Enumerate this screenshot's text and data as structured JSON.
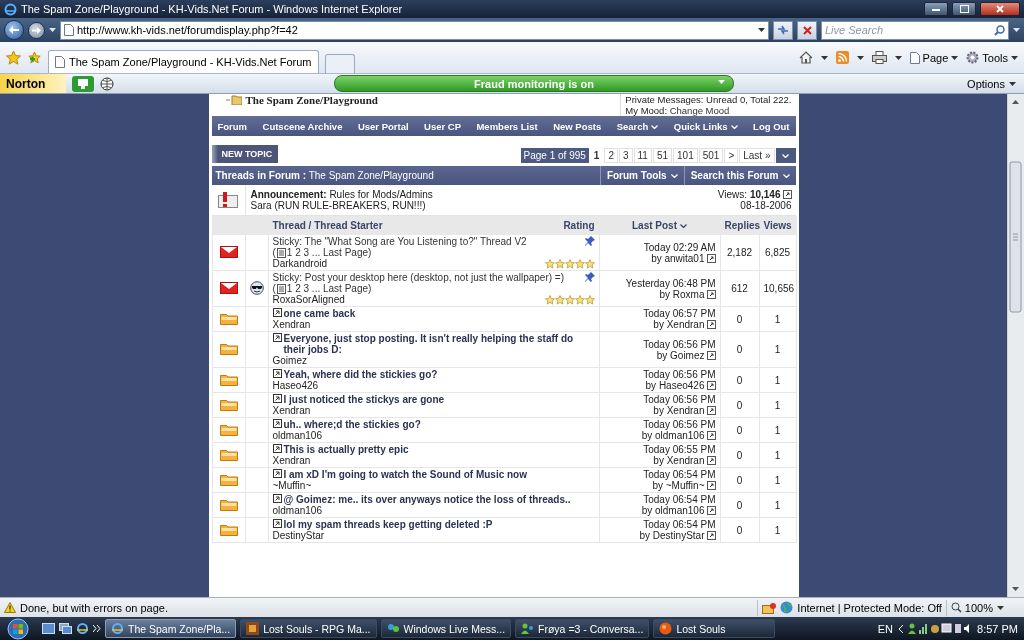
{
  "window": {
    "title": "The Spam Zone/Playground - KH-Vids.Net Forum - Windows Internet Explorer"
  },
  "address_bar": {
    "url": "http://www.kh-vids.net/forumdisplay.php?f=42"
  },
  "search": {
    "placeholder": "Live Search"
  },
  "tabs": [
    {
      "label": "The Spam Zone/Playground - KH-Vids.Net Forum",
      "selected": true
    }
  ],
  "command_bar": [
    {
      "label": "Page"
    },
    {
      "label": "Tools"
    }
  ],
  "norton": {
    "logo": "Norton",
    "status": "Fraud monitoring is on",
    "options": "Options"
  },
  "forum": {
    "title": "The Spam Zone/Playground",
    "messages": "Private Messages: Unread 0, Total 222.",
    "mood_label": "My Mood:",
    "mood_link": "Change Mood"
  },
  "nav": [
    {
      "label": "Forum",
      "menu": false
    },
    {
      "label": "Cutscene Archive",
      "menu": false
    },
    {
      "label": "User Portal",
      "menu": false
    },
    {
      "label": "User CP",
      "menu": false
    },
    {
      "label": "Members List",
      "menu": false
    },
    {
      "label": "New Posts",
      "menu": false
    },
    {
      "label": "Search",
      "menu": true
    },
    {
      "label": "Quick Links",
      "menu": true
    },
    {
      "label": "Log Out",
      "menu": false
    }
  ],
  "new_topic": "NEW TOPIC",
  "pagination": {
    "summary": "Page 1 of 995",
    "pages": [
      {
        "label": "1",
        "selected": true
      },
      {
        "label": "2",
        "selected": false
      },
      {
        "label": "3",
        "selected": false
      },
      {
        "label": "11",
        "selected": false
      },
      {
        "label": "51",
        "selected": false
      },
      {
        "label": "101",
        "selected": false
      },
      {
        "label": "501",
        "selected": false
      },
      {
        "label": ">",
        "selected": false
      },
      {
        "label": "Last »",
        "selected": false
      }
    ]
  },
  "threads_header": {
    "title": "**Threads in Forum :** The Spam Zone/Playground",
    "menus": [
      {
        "label": "Forum Tools"
      },
      {
        "label": "Search this Forum"
      }
    ]
  },
  "announcement": {
    "title": "**Announcement:** Rules for Mods/Admins",
    "author": "Sara (RUN RULE-BREAKERS, RUN!!!)",
    "views": "Views: **10,146**",
    "date": "08-18-2006"
  },
  "columns": [
    {
      "label": "Thread / Thread Starter",
      "sorted": false
    },
    {
      "label": "Rating",
      "sorted": false
    },
    {
      "label": "Last Post",
      "sorted": true
    },
    {
      "label": "Replies",
      "sorted": false
    },
    {
      "label": "Views",
      "sorted": false
    }
  ],
  "threads": [
    {
      "kind": "sticky",
      "thread_icon": false,
      "prefix": "Sticky:",
      "title": "The \"What Song are You Listening to?\" Thread V2",
      "pages_open": "(",
      "pages": "1 2 3 ... Last Page)",
      "starter": "Darkandroid",
      "stars": 5,
      "time": "Today 02:29 AM",
      "by": "by anwita01",
      "replies": "2,182",
      "views": "6,825"
    },
    {
      "kind": "sticky",
      "thread_icon": true,
      "prefix": "Sticky:",
      "title": "Post your desktop here (desktop, not just the wallpaper) =)",
      "pages_open": "(",
      "pages": "1 2 3 ... Last Page)",
      "starter": "RoxaSorAligned",
      "stars": 5,
      "time": "Yesterday 06:48 PM",
      "by": "by Roxma",
      "replies": "612",
      "views": "10,656"
    },
    {
      "kind": "normal",
      "title": "one came back",
      "starter": "Xendran",
      "time": "Today 06:57 PM",
      "by": "by Xendran",
      "replies": "0",
      "views": "1"
    },
    {
      "kind": "normal",
      "title": "Everyone, just stop posting. It isn't really helping the staff do their jobs D:",
      "starter": "Goimez",
      "time": "Today 06:56 PM",
      "by": "by Goimez",
      "replies": "0",
      "views": "1"
    },
    {
      "kind": "normal",
      "title": "Yeah, where did the stickies go?",
      "starter": "Haseo426",
      "time": "Today 06:56 PM",
      "by": "by Haseo426",
      "replies": "0",
      "views": "1"
    },
    {
      "kind": "normal",
      "title": "I just noticed the stickys are gone",
      "starter": "Xendran",
      "time": "Today 06:56 PM",
      "by": "by Xendran",
      "replies": "0",
      "views": "1"
    },
    {
      "kind": "normal",
      "title": "uh.. where;d the stickies go?",
      "starter": "oldman106",
      "time": "Today 06:56 PM",
      "by": "by oldman106",
      "replies": "0",
      "views": "1"
    },
    {
      "kind": "normal",
      "title": "This is actually pretty epic",
      "starter": "Xendran",
      "time": "Today 06:55 PM",
      "by": "by Xendran",
      "replies": "0",
      "views": "1"
    },
    {
      "kind": "normal",
      "title": "I am xD I'm going to watch the Sound of Music now",
      "starter": "~Muffin~",
      "time": "Today 06:54 PM",
      "by": "by ~Muffin~",
      "replies": "0",
      "views": "1"
    },
    {
      "kind": "normal",
      "title": "@ Goimez: me.. its over anyways notice the loss of threads..",
      "starter": "oldman106",
      "time": "Today 06:54 PM",
      "by": "by oldman106",
      "replies": "0",
      "views": "1"
    },
    {
      "kind": "normal",
      "title": "lol my spam threads keep getting deleted :P",
      "starter": "DestinyStar",
      "time": "Today 06:54 PM",
      "by": "by DestinyStar",
      "replies": "0",
      "views": "1"
    }
  ],
  "status_bar": {
    "message": "Done, but with errors on page.",
    "zone": "Internet | Protected Mode: Off",
    "zoom": "100%"
  },
  "taskbar": {
    "tasks": [
      {
        "label": "The Spam Zone/Pla...",
        "kind": "browser",
        "selected": true
      },
      {
        "label": "Lost Souls - RPG Ma...",
        "kind": "game",
        "selected": false
      },
      {
        "label": "Windows Live Mess...",
        "kind": "messenger",
        "selected": false
      },
      {
        "label": "Frøya =3 - Conversa...",
        "kind": "chat",
        "selected": false
      },
      {
        "label": "Lost Souls",
        "kind": "ball",
        "selected": false
      }
    ],
    "language": "EN",
    "clock": "8:57 PM"
  }
}
